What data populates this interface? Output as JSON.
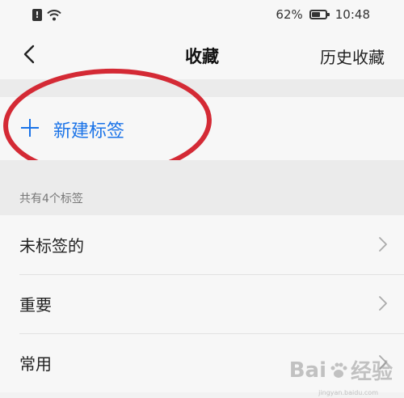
{
  "status_bar": {
    "battery_percent": "62%",
    "battery_level": 0.62,
    "time": "10:48"
  },
  "header": {
    "back_icon": "chevron-left-icon",
    "title": "收藏",
    "history_label": "历史收藏"
  },
  "new_tag": {
    "icon": "plus-icon",
    "label": "新建标签"
  },
  "section": {
    "count_label": "共有4个标签"
  },
  "tags": [
    {
      "label": "未标签的"
    },
    {
      "label": "重要"
    },
    {
      "label": "常用"
    }
  ],
  "colors": {
    "accent": "#1a73e8",
    "annotation": "#d42a35",
    "background": "#f2f2f2"
  },
  "watermark": {
    "brand_left": "Bai",
    "brand_right": "经验",
    "url": "jingyan.baidu.com"
  }
}
